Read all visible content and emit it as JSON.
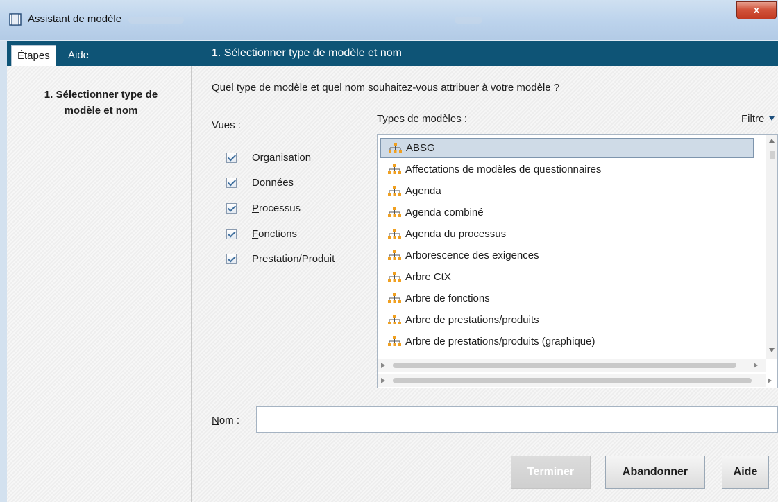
{
  "window": {
    "title": "Assistant de modèle",
    "close_label": "x"
  },
  "left_panel": {
    "tabs": [
      {
        "label": "Étapes",
        "active": true
      },
      {
        "label": "Aide",
        "active": false
      }
    ],
    "step_title": "1. Sélectionner type de modèle et nom"
  },
  "main": {
    "header": "1. Sélectionner type de modèle et nom",
    "question": "Quel type de modèle et quel nom souhaitez-vous attribuer à votre modèle ?",
    "views_label": "Vues :",
    "views": [
      {
        "label": "Organisation",
        "mnemonic": "O",
        "rest": "rganisation",
        "pre": "",
        "checked": true
      },
      {
        "label": "Données",
        "mnemonic": "D",
        "rest": "onnées",
        "pre": "",
        "checked": true
      },
      {
        "label": "Processus",
        "mnemonic": "P",
        "rest": "rocessus",
        "pre": "",
        "checked": true
      },
      {
        "label": "Fonctions",
        "mnemonic": "F",
        "rest": "onctions",
        "pre": "",
        "checked": true
      },
      {
        "label": "Prestation/Produit",
        "mnemonic": "s",
        "rest": "tation/Produit",
        "pre": "Pre",
        "checked": true
      }
    ],
    "types_label": "Types de modèles :",
    "filter_label": "Filtre",
    "model_types": [
      "ABSG",
      "Affectations de modèles de questionnaires",
      "Agenda",
      "Agenda combiné",
      "Agenda du processus",
      "Arborescence des exigences",
      "Arbre CtX",
      "Arbre de fonctions",
      "Arbre de prestations/produits",
      "Arbre de prestations/produits (graphique)"
    ],
    "selected_type_index": 0,
    "name_label": "Nom :",
    "name_mnemonic": "N",
    "name_rest": "om :",
    "name_value": "",
    "buttons": {
      "finish": {
        "label": "Terminer",
        "mnemonic": "T",
        "rest": "erminer",
        "enabled": false
      },
      "cancel": {
        "label": "Abandonner",
        "enabled": true
      },
      "help": {
        "label": "Aide",
        "pre": "Ai",
        "mnemonic": "d",
        "rest": "e",
        "enabled": true
      }
    }
  },
  "colors": {
    "header_bg": "#0e5476",
    "selection_bg": "#cfdbe7",
    "icon_orange": "#f0a020"
  }
}
